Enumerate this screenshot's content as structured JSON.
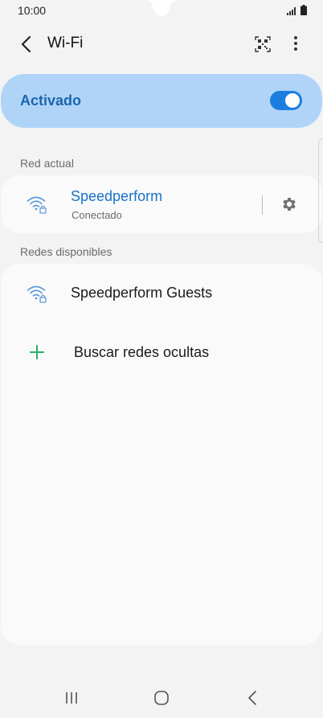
{
  "status_bar": {
    "time": "10:00"
  },
  "app_bar": {
    "title": "Wi-Fi"
  },
  "master_switch": {
    "label": "Activado",
    "state": "on"
  },
  "sections": {
    "current_header": "Red actual",
    "available_header": "Redes disponibles"
  },
  "current_network": {
    "name": "Speedperform",
    "status": "Conectado"
  },
  "available_networks": [
    {
      "name": "Speedperform Guests"
    }
  ],
  "add_network": {
    "label": "Buscar redes ocultas"
  },
  "colors": {
    "accent": "#1a73c8",
    "master_bg": "#b0d4f8",
    "toggle_on": "#1a7ee0",
    "add_green": "#2bb26a"
  },
  "icons": [
    "back-icon",
    "qr-code-icon",
    "more-vert-icon",
    "wifi-lock-icon",
    "gear-icon",
    "plus-icon",
    "nav-recents-icon",
    "nav-home-icon",
    "nav-back-icon"
  ]
}
